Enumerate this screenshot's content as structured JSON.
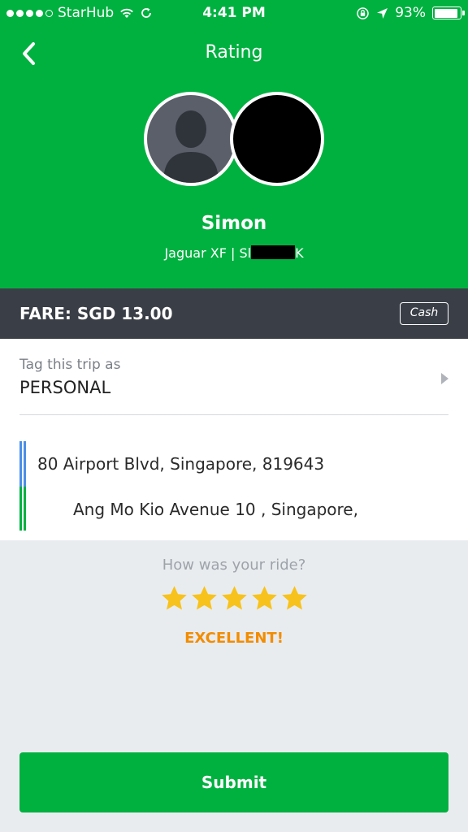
{
  "status_bar": {
    "carrier": "StarHub",
    "time": "4:41 PM",
    "battery": "93%",
    "battery_level": 0.93
  },
  "nav": {
    "title": "Rating",
    "back_icon": "chevron-left-icon"
  },
  "driver": {
    "name": "Simon",
    "vehicle_prefix": "Jaguar XF | Sl",
    "vehicle_suffix": "K"
  },
  "fare": {
    "label": "FARE: SGD 13.00",
    "payment_method": "Cash"
  },
  "trip_tag": {
    "label": "Tag this trip as",
    "value": "PERSONAL"
  },
  "route": {
    "pickup": "80 Airport Blvd, Singapore, 819643",
    "dropoff": "Ang Mo Kio Avenue 10 , Singapore,"
  },
  "rating": {
    "question": "How was your ride?",
    "stars": 5,
    "max_stars": 5,
    "label": "EXCELLENT!"
  },
  "submit_label": "Submit",
  "colors": {
    "brand_green": "#00b140",
    "fare_bar": "#3a3f47",
    "star": "#f7c21b",
    "rating_word": "#f28c00",
    "pickup_line": "#4a8fe7"
  }
}
